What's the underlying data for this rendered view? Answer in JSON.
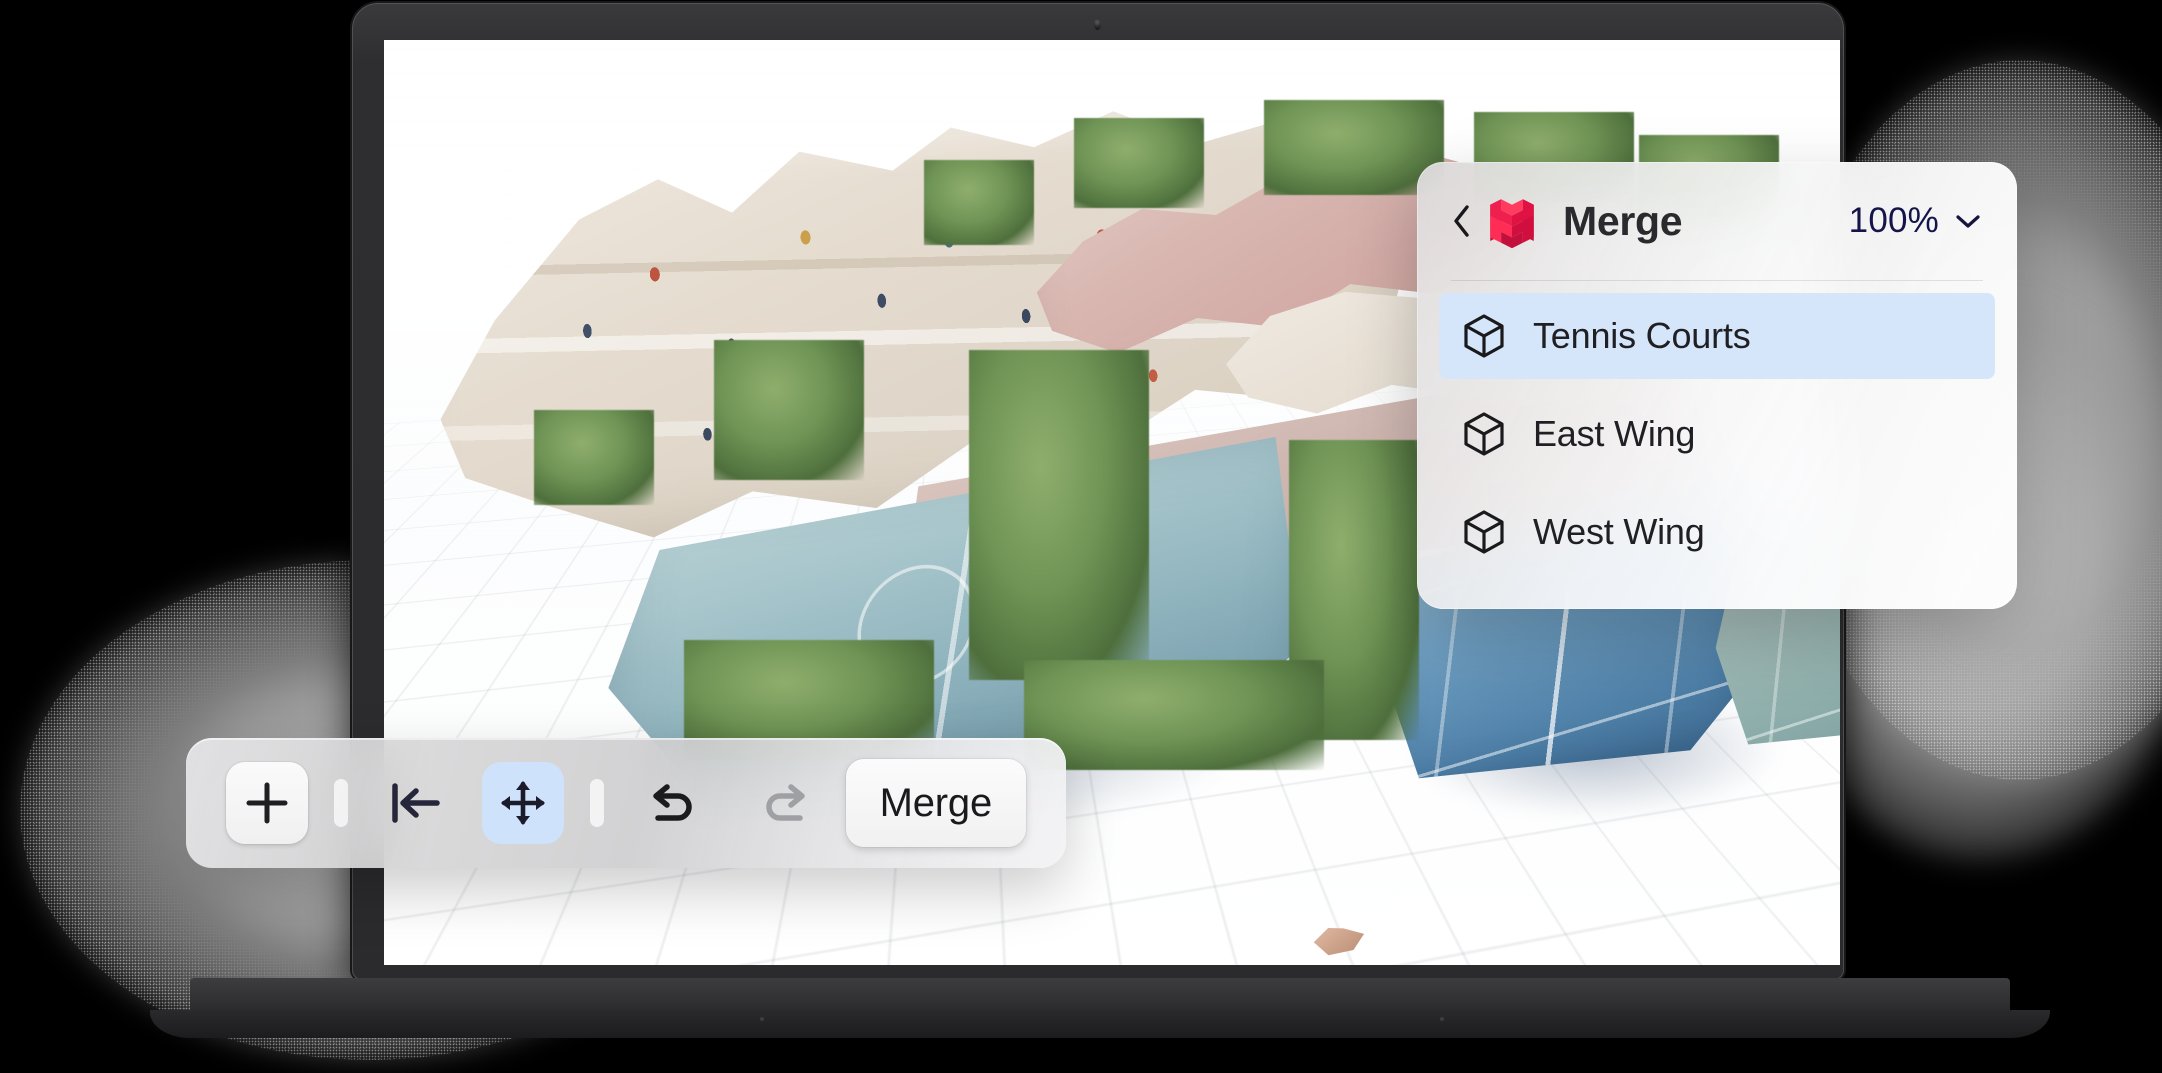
{
  "app": {
    "name": "Merge",
    "device": "laptop"
  },
  "viewport": {
    "scene_description": "3D photogrammetry scan of a dense building complex with rooftops above tennis and sports courts",
    "background": "#ffffff",
    "grid": "perspective floor grid"
  },
  "panel": {
    "back_label": "‹",
    "logo_name": "merge-logo",
    "title": "Merge",
    "zoom_value": "100%",
    "zoom_chevron": "chevron-down-icon",
    "layers": [
      {
        "label": "Tennis Courts",
        "icon": "cube-icon",
        "selected": true
      },
      {
        "label": "East Wing",
        "icon": "cube-icon",
        "selected": false
      },
      {
        "label": "West Wing",
        "icon": "cube-icon",
        "selected": false
      }
    ]
  },
  "toolbar": {
    "add_label": "+",
    "add_name": "plus-icon",
    "align_start_name": "align-to-start-icon",
    "move_name": "move-tool-icon",
    "move_active": true,
    "undo_name": "undo-icon",
    "undo_enabled": true,
    "redo_name": "redo-icon",
    "redo_enabled": false,
    "merge_label": "Merge"
  },
  "colors": {
    "accent_selection": "#d5e6fb",
    "brand_red": "#f0204e",
    "brand_red_dark": "#c20f3c",
    "zoom_text": "#14144a",
    "panel_text": "#202024",
    "icon_dark": "#1f1f30",
    "icon_disabled": "#9a9a9e"
  }
}
